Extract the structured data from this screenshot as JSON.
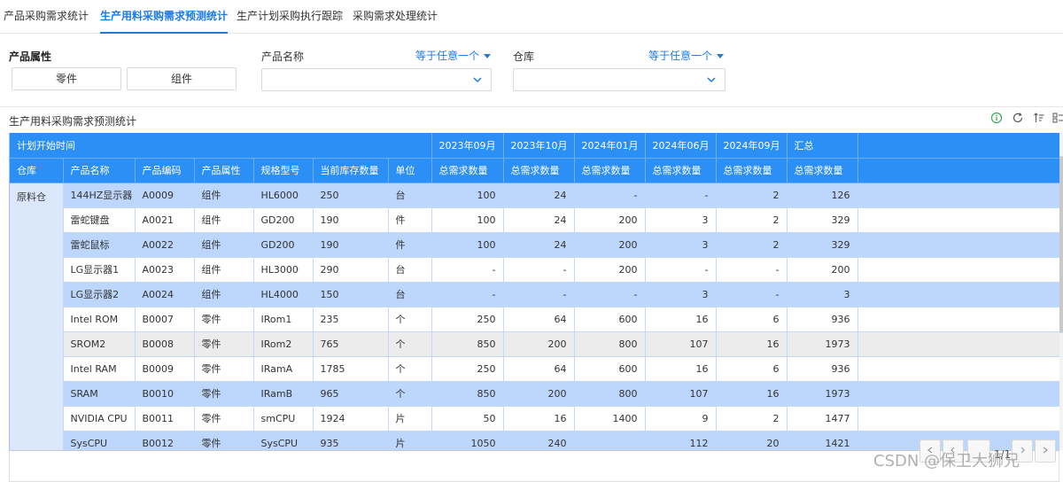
{
  "tabs": [
    {
      "label": "产品采购需求统计"
    },
    {
      "label": "生产用料采购需求预测统计"
    },
    {
      "label": "生产计划采购执行跟踪"
    },
    {
      "label": "采购需求处理统计"
    }
  ],
  "filters": {
    "attribute": {
      "label": "产品属性",
      "options": [
        "零件",
        "组件"
      ]
    },
    "product_name": {
      "label": "产品名称",
      "operator": "等于任意一个",
      "value": ""
    },
    "warehouse": {
      "label": "仓库",
      "operator": "等于任意一个",
      "value": ""
    }
  },
  "panel": {
    "title": "生产用料采购需求预测统计"
  },
  "table": {
    "group_header": "计划开始时间",
    "period_headers": [
      "2023年09月",
      "2023年10月",
      "2024年01月",
      "2024年06月",
      "2024年09月",
      "汇总"
    ],
    "columns": [
      "仓库",
      "产品名称",
      "产品编码",
      "产品属性",
      "规格型号",
      "当前库存数量",
      "单位"
    ],
    "measure": "总需求数量",
    "warehouse": "原料仓",
    "rows": [
      {
        "name": "144HZ显示器",
        "code": "A0009",
        "attr": "组件",
        "spec": "HL6000",
        "stock": "250",
        "unit": "台",
        "v": [
          "100",
          "24",
          "-",
          "-",
          "2",
          "126"
        ]
      },
      {
        "name": "雷蛇键盘",
        "code": "A0021",
        "attr": "组件",
        "spec": "GD200",
        "stock": "190",
        "unit": "件",
        "v": [
          "100",
          "24",
          "200",
          "3",
          "2",
          "329"
        ]
      },
      {
        "name": "雷蛇鼠标",
        "code": "A0022",
        "attr": "组件",
        "spec": "GD200",
        "stock": "190",
        "unit": "件",
        "v": [
          "100",
          "24",
          "200",
          "3",
          "2",
          "329"
        ]
      },
      {
        "name": "LG显示器1",
        "code": "A0023",
        "attr": "组件",
        "spec": "HL3000",
        "stock": "290",
        "unit": "台",
        "v": [
          "-",
          "-",
          "200",
          "-",
          "-",
          "200"
        ]
      },
      {
        "name": "LG显示器2",
        "code": "A0024",
        "attr": "组件",
        "spec": "HL4000",
        "stock": "150",
        "unit": "台",
        "v": [
          "-",
          "-",
          "-",
          "3",
          "-",
          "3"
        ]
      },
      {
        "name": "Intel ROM",
        "code": "B0007",
        "attr": "零件",
        "spec": "IRom1",
        "stock": "235",
        "unit": "个",
        "v": [
          "250",
          "64",
          "600",
          "16",
          "6",
          "936"
        ]
      },
      {
        "name": "SROM2",
        "code": "B0008",
        "attr": "零件",
        "spec": "IRom2",
        "stock": "765",
        "unit": "个",
        "v": [
          "850",
          "200",
          "800",
          "107",
          "16",
          "1973"
        ]
      },
      {
        "name": "Intel RAM",
        "code": "B0009",
        "attr": "零件",
        "spec": "IRamA",
        "stock": "1785",
        "unit": "个",
        "v": [
          "250",
          "64",
          "600",
          "16",
          "6",
          "936"
        ]
      },
      {
        "name": "SRAM",
        "code": "B0010",
        "attr": "零件",
        "spec": "IRamB",
        "stock": "965",
        "unit": "个",
        "v": [
          "850",
          "200",
          "800",
          "107",
          "16",
          "1973"
        ]
      },
      {
        "name": "NVIDIA CPU",
        "code": "B0011",
        "attr": "零件",
        "spec": "smCPU",
        "stock": "1924",
        "unit": "片",
        "v": [
          "50",
          "16",
          "1400",
          "9",
          "2",
          "1477"
        ]
      },
      {
        "name": "SysCPU",
        "code": "B0012",
        "attr": "零件",
        "spec": "SysCPU",
        "stock": "935",
        "unit": "片",
        "v": [
          "1050",
          "240",
          "",
          "112",
          "20",
          "1421"
        ]
      }
    ]
  },
  "pagination": {
    "page_text": "1/1"
  },
  "watermark": "CSDN @保卫大狮兄",
  "colors": {
    "accent": "#1f7ae0",
    "header": "#2b8ff5",
    "row_blue": "#bcd7fb",
    "row_grey": "#ececec"
  }
}
